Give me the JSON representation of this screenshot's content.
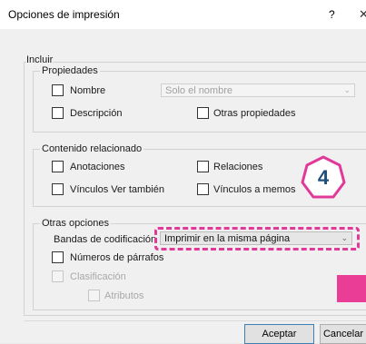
{
  "dialog": {
    "title": "Opciones de impresión",
    "help_label": "?",
    "close_label": "✕"
  },
  "incluir": {
    "label": "Incluir",
    "propiedades": {
      "label": "Propiedades",
      "nombre_label": "Nombre",
      "nombre_select_value": "Solo el nombre",
      "descripcion_label": "Descripción",
      "otras_propiedades_label": "Otras propiedades"
    },
    "contenido_relacionado": {
      "label": "Contenido relacionado",
      "anotaciones_label": "Anotaciones",
      "relaciones_label": "Relaciones",
      "vinculos_ver_tambien_label": "Vínculos Ver también",
      "vinculos_memos_label": "Vínculos a memos"
    },
    "otras_opciones": {
      "label": "Otras opciones",
      "bandas_label": "Bandas de codificación",
      "bandas_select_value": "Imprimir en la misma página",
      "numeros_parrafos_label": "Números de párrafos",
      "clasificacion_label": "Clasificación",
      "atributos_label": "Atributos"
    }
  },
  "callout": {
    "step_number": "4",
    "color": "#e0399a"
  },
  "buttons": {
    "accept_label": "Aceptar",
    "cancel_label": "Cancelar"
  },
  "icons": {
    "dropdown": "chevron-down-icon",
    "close": "close-icon",
    "help": "help-icon"
  }
}
